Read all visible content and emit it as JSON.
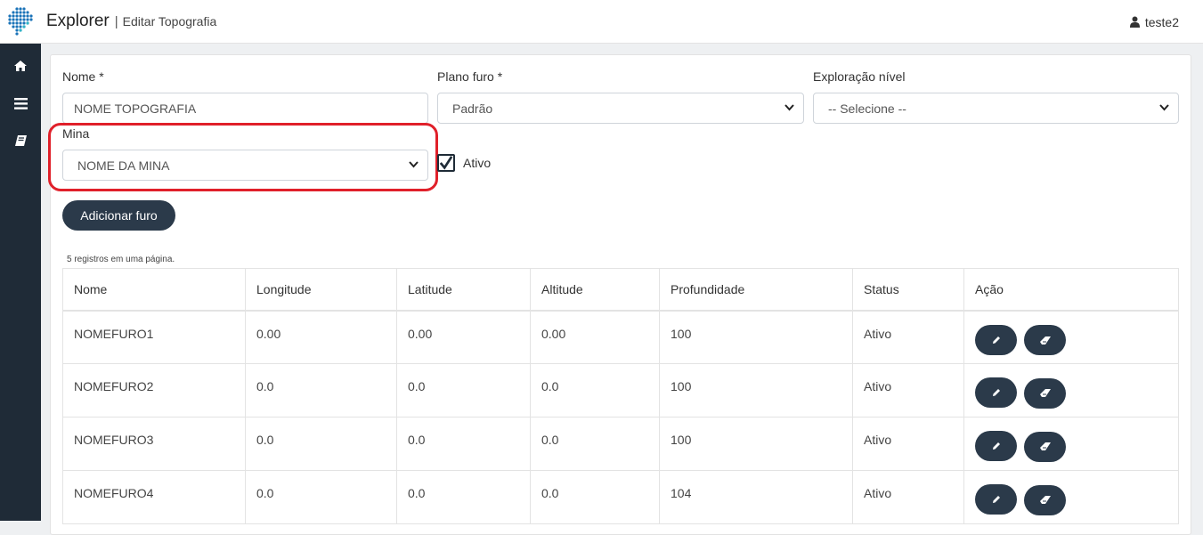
{
  "header": {
    "brand": "Explorer",
    "separator": "|",
    "subtitle": "Editar Topografia",
    "user": "teste2"
  },
  "sidebar": {
    "items": [
      {
        "icon": "home-icon"
      },
      {
        "icon": "menu-icon"
      },
      {
        "icon": "book-icon"
      }
    ]
  },
  "form": {
    "nome_label": "Nome *",
    "nome_value": "NOME TOPOGRAFIA",
    "plano_label": "Plano furo *",
    "plano_value": "Padrão",
    "exploracao_label": "Exploração nível",
    "exploracao_value": "-- Selecione --",
    "mina_label": "Mina",
    "mina_value": "NOME DA MINA",
    "ativo_label": "Ativo",
    "ativo_checked": true,
    "add_button": "Adicionar furo"
  },
  "table": {
    "records_text": "5 registros em uma página.",
    "headers": [
      "Nome",
      "Longitude",
      "Latitude",
      "Altitude",
      "Profundidade",
      "Status",
      "Ação"
    ],
    "rows": [
      [
        "NOMEFURO1",
        "0.00",
        "0.00",
        "0.00",
        "100",
        "Ativo"
      ],
      [
        "NOMEFURO2",
        "0.0",
        "0.0",
        "0.0",
        "100",
        "Ativo"
      ],
      [
        "NOMEFURO3",
        "0.0",
        "0.0",
        "0.0",
        "100",
        "Ativo"
      ],
      [
        "NOMEFURO4",
        "0.0",
        "0.0",
        "0.0",
        "104",
        "Ativo"
      ]
    ]
  },
  "colors": {
    "sidebar": "#1f2b37",
    "button": "#2b3a4a",
    "highlight": "#e0202a"
  }
}
